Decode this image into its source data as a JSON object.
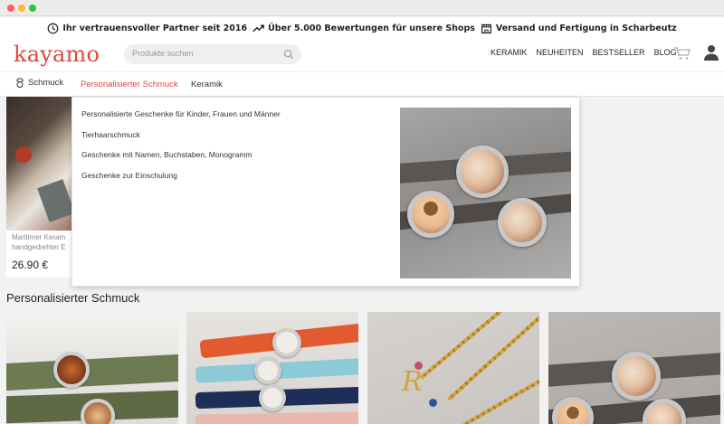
{
  "trust_bar": {
    "items": [
      {
        "icon": "clock-icon",
        "text": "Ihr vertrauensvoller Partner seit 2016"
      },
      {
        "icon": "trending-up-icon",
        "text": "Über 5.000 Bewertungen für unsere Shops"
      },
      {
        "icon": "storefront-icon",
        "text": "Versand und Fertigung in Scharbeutz"
      }
    ]
  },
  "header": {
    "logo": "kayamo",
    "search_placeholder": "Produkte suchen",
    "nav": [
      "KERAMIK",
      "NEUHEITEN",
      "BESTSELLER",
      "BLOG"
    ]
  },
  "category_nav": {
    "items": [
      "Schmuck",
      "Personalisierter Schmuck",
      "Keramik"
    ],
    "active": "Personalisierter Schmuck"
  },
  "dropdown": {
    "links": [
      "Personalisierte Geschenke für Kinder, Frauen und Männer",
      "Tierhaarschmuck",
      "Geschenke mit Namen, Buchstaben, Monogramm",
      "Geschenke zur Einschulung"
    ]
  },
  "background_card": {
    "title_line1": "Maritimer Keram",
    "title_line2": "handgedrehter E",
    "price": "26.90 €"
  },
  "section": {
    "title": "Personalisierter Schmuck"
  },
  "colors": {
    "brand": "#d94a3d",
    "active_nav": "#d94a3d"
  }
}
